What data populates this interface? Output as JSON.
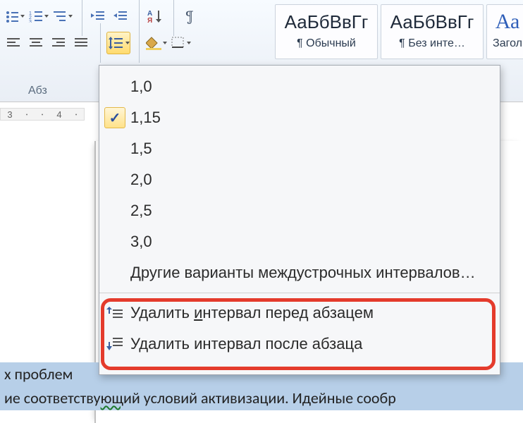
{
  "ribbon": {
    "group_label": "Абз",
    "buttons": {
      "bullets": "bullets",
      "numbering": "numbering",
      "multilevel": "multilevel",
      "dec_indent": "decrease-indent",
      "inc_indent": "increase-indent",
      "sort": "sort",
      "pilcrow": "¶",
      "align_left": "align-left",
      "align_center": "align-center",
      "align_right": "align-right",
      "align_justify": "align-justify",
      "line_spacing": "line-spacing",
      "shading": "shading",
      "borders": "borders"
    }
  },
  "styles": {
    "sample_text": "АаБбВвГг",
    "heading_sample": "Аа",
    "items": [
      {
        "label": "¶ Обычный"
      },
      {
        "label": "¶ Без инте…"
      },
      {
        "label": "Загол"
      }
    ]
  },
  "ruler": {
    "marks": [
      "3",
      "4"
    ]
  },
  "spacing_menu": {
    "values": [
      "1,0",
      "1,15",
      "1,5",
      "2,0",
      "2,5",
      "3,0"
    ],
    "selected_index": 1,
    "more": "Другие варианты междустрочных интервалов…",
    "remove_before_pre": "Удалить ",
    "remove_before_u": "и",
    "remove_before_post": "нтервал перед абзацем",
    "remove_after": "Удалить интервал после абзаца"
  },
  "document": {
    "line1_a": "х проблем",
    "line2_a": "ие соответству",
    "line2_b": "ющ",
    "line2_c": "ий условий активизации. Идейные сообр"
  }
}
